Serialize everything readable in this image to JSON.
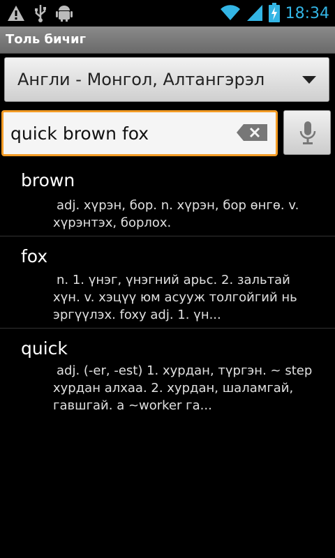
{
  "status_bar": {
    "time": "18:34",
    "colors": {
      "accent": "#33b5e5"
    }
  },
  "app": {
    "title": "Толь бичиг"
  },
  "dictionary_select": {
    "selected": "Англи - Монгол, Алтангэрэл"
  },
  "search": {
    "value": "quick brown fox",
    "placeholder": ""
  },
  "results": [
    {
      "word": "brown",
      "definition": "adj. хүрэн, бор. n. хүрэн, бор өнгө. v. хүрэнтэх, борлох."
    },
    {
      "word": "fox",
      "definition": "n. 1. үнэг, үнэгний арьс. 2. зальтай хүн. v. хэцүү юм асууж толгойгий нь эргүүлэх. foxy  adj. 1. үн..."
    },
    {
      "word": "quick",
      "definition": "adj. (-er, -est) 1. хурдан, түргэн. ~ step хурдан алхаа. 2. хурдан, шаламгай, гавшгай. a ~worker га..."
    }
  ],
  "colors": {
    "search_focus": "#f39c26"
  }
}
